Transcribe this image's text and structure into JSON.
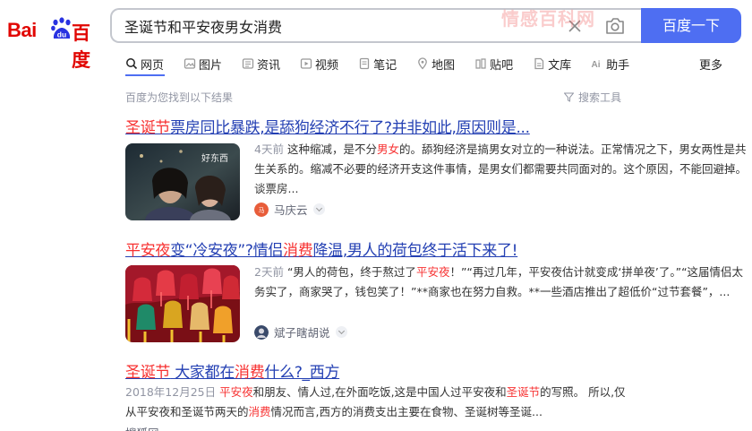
{
  "logo": {
    "text_bai": "Bai",
    "text_du": "du",
    "text_cn": "百度"
  },
  "search": {
    "query": "圣诞节和平安夜男女消费",
    "button_label": "百度一下"
  },
  "watermark": "情感百科网",
  "tabs": [
    {
      "label": "网页",
      "icon": "search-icon"
    },
    {
      "label": "图片",
      "icon": "image-icon"
    },
    {
      "label": "资讯",
      "icon": "news-icon"
    },
    {
      "label": "视频",
      "icon": "video-icon"
    },
    {
      "label": "笔记",
      "icon": "note-icon"
    },
    {
      "label": "地图",
      "icon": "map-icon"
    },
    {
      "label": "贴吧",
      "icon": "tieba-icon"
    },
    {
      "label": "文库",
      "icon": "wenku-icon"
    },
    {
      "label": "助手",
      "icon": "ai-icon"
    }
  ],
  "tabs_more": "更多",
  "result_count": "百度为您找到以下结果",
  "tools_label": "搜索工具",
  "results": [
    {
      "title_em": "圣诞节",
      "title_rest": "票房同比暴跌,是舔狗经济不行了?并非如此,原因则是...",
      "date": "4天前",
      "snippet_a": "这种缩减，是不分",
      "snippet_em": "男女",
      "snippet_b": "的。舔狗经济是搞男女对立的一种说法。正常情况之下，男女两性是共生关系的。缩减不必要的经济开支这件事情，是男女们都需要共同面对的。这个原因，不能回避掉。谈票房...",
      "source": "马庆云"
    },
    {
      "title_em": "平安夜",
      "title_mid": "变“冷安夜”?情侣",
      "title_em2": "消费",
      "title_rest": "降温,男人的荷包终于活下来了!",
      "date": "2天前",
      "snippet_a": "“男人的荷包，终于熬过了",
      "snippet_em": "平安夜",
      "snippet_b": "！”“再过几年，平安夜估计就变成‘拼单夜’了。”“这届情侣太务实了，商家哭了，钱包笑了！”**商家也在努力自救。**一些酒店推出了超低价“过节套餐”，...",
      "source": "斌子瞎胡说"
    },
    {
      "title_em": "圣诞节",
      "title_mid": " 大家都在",
      "title_em2": "消费",
      "title_rest": "什么?_西方",
      "date": "2018年12月25日",
      "snippet_em": "平安夜",
      "snippet_a": "和朋友、情人过,在外面吃饭,这是中国人过平安夜和",
      "snippet_em2": "圣诞节",
      "snippet_b": "的写照。 所以,仅从平安夜和圣诞节两天的",
      "snippet_em3": "消费",
      "snippet_c": "情况而言,西方的消费支出主要在食物、圣诞树等圣诞...",
      "source": "搜狐网"
    }
  ],
  "colors": {
    "accent": "#4e6ef2",
    "brand_red": "#e10602",
    "brand_blue": "#2932e1",
    "link": "#2440b3",
    "highlight": "#f73131"
  }
}
